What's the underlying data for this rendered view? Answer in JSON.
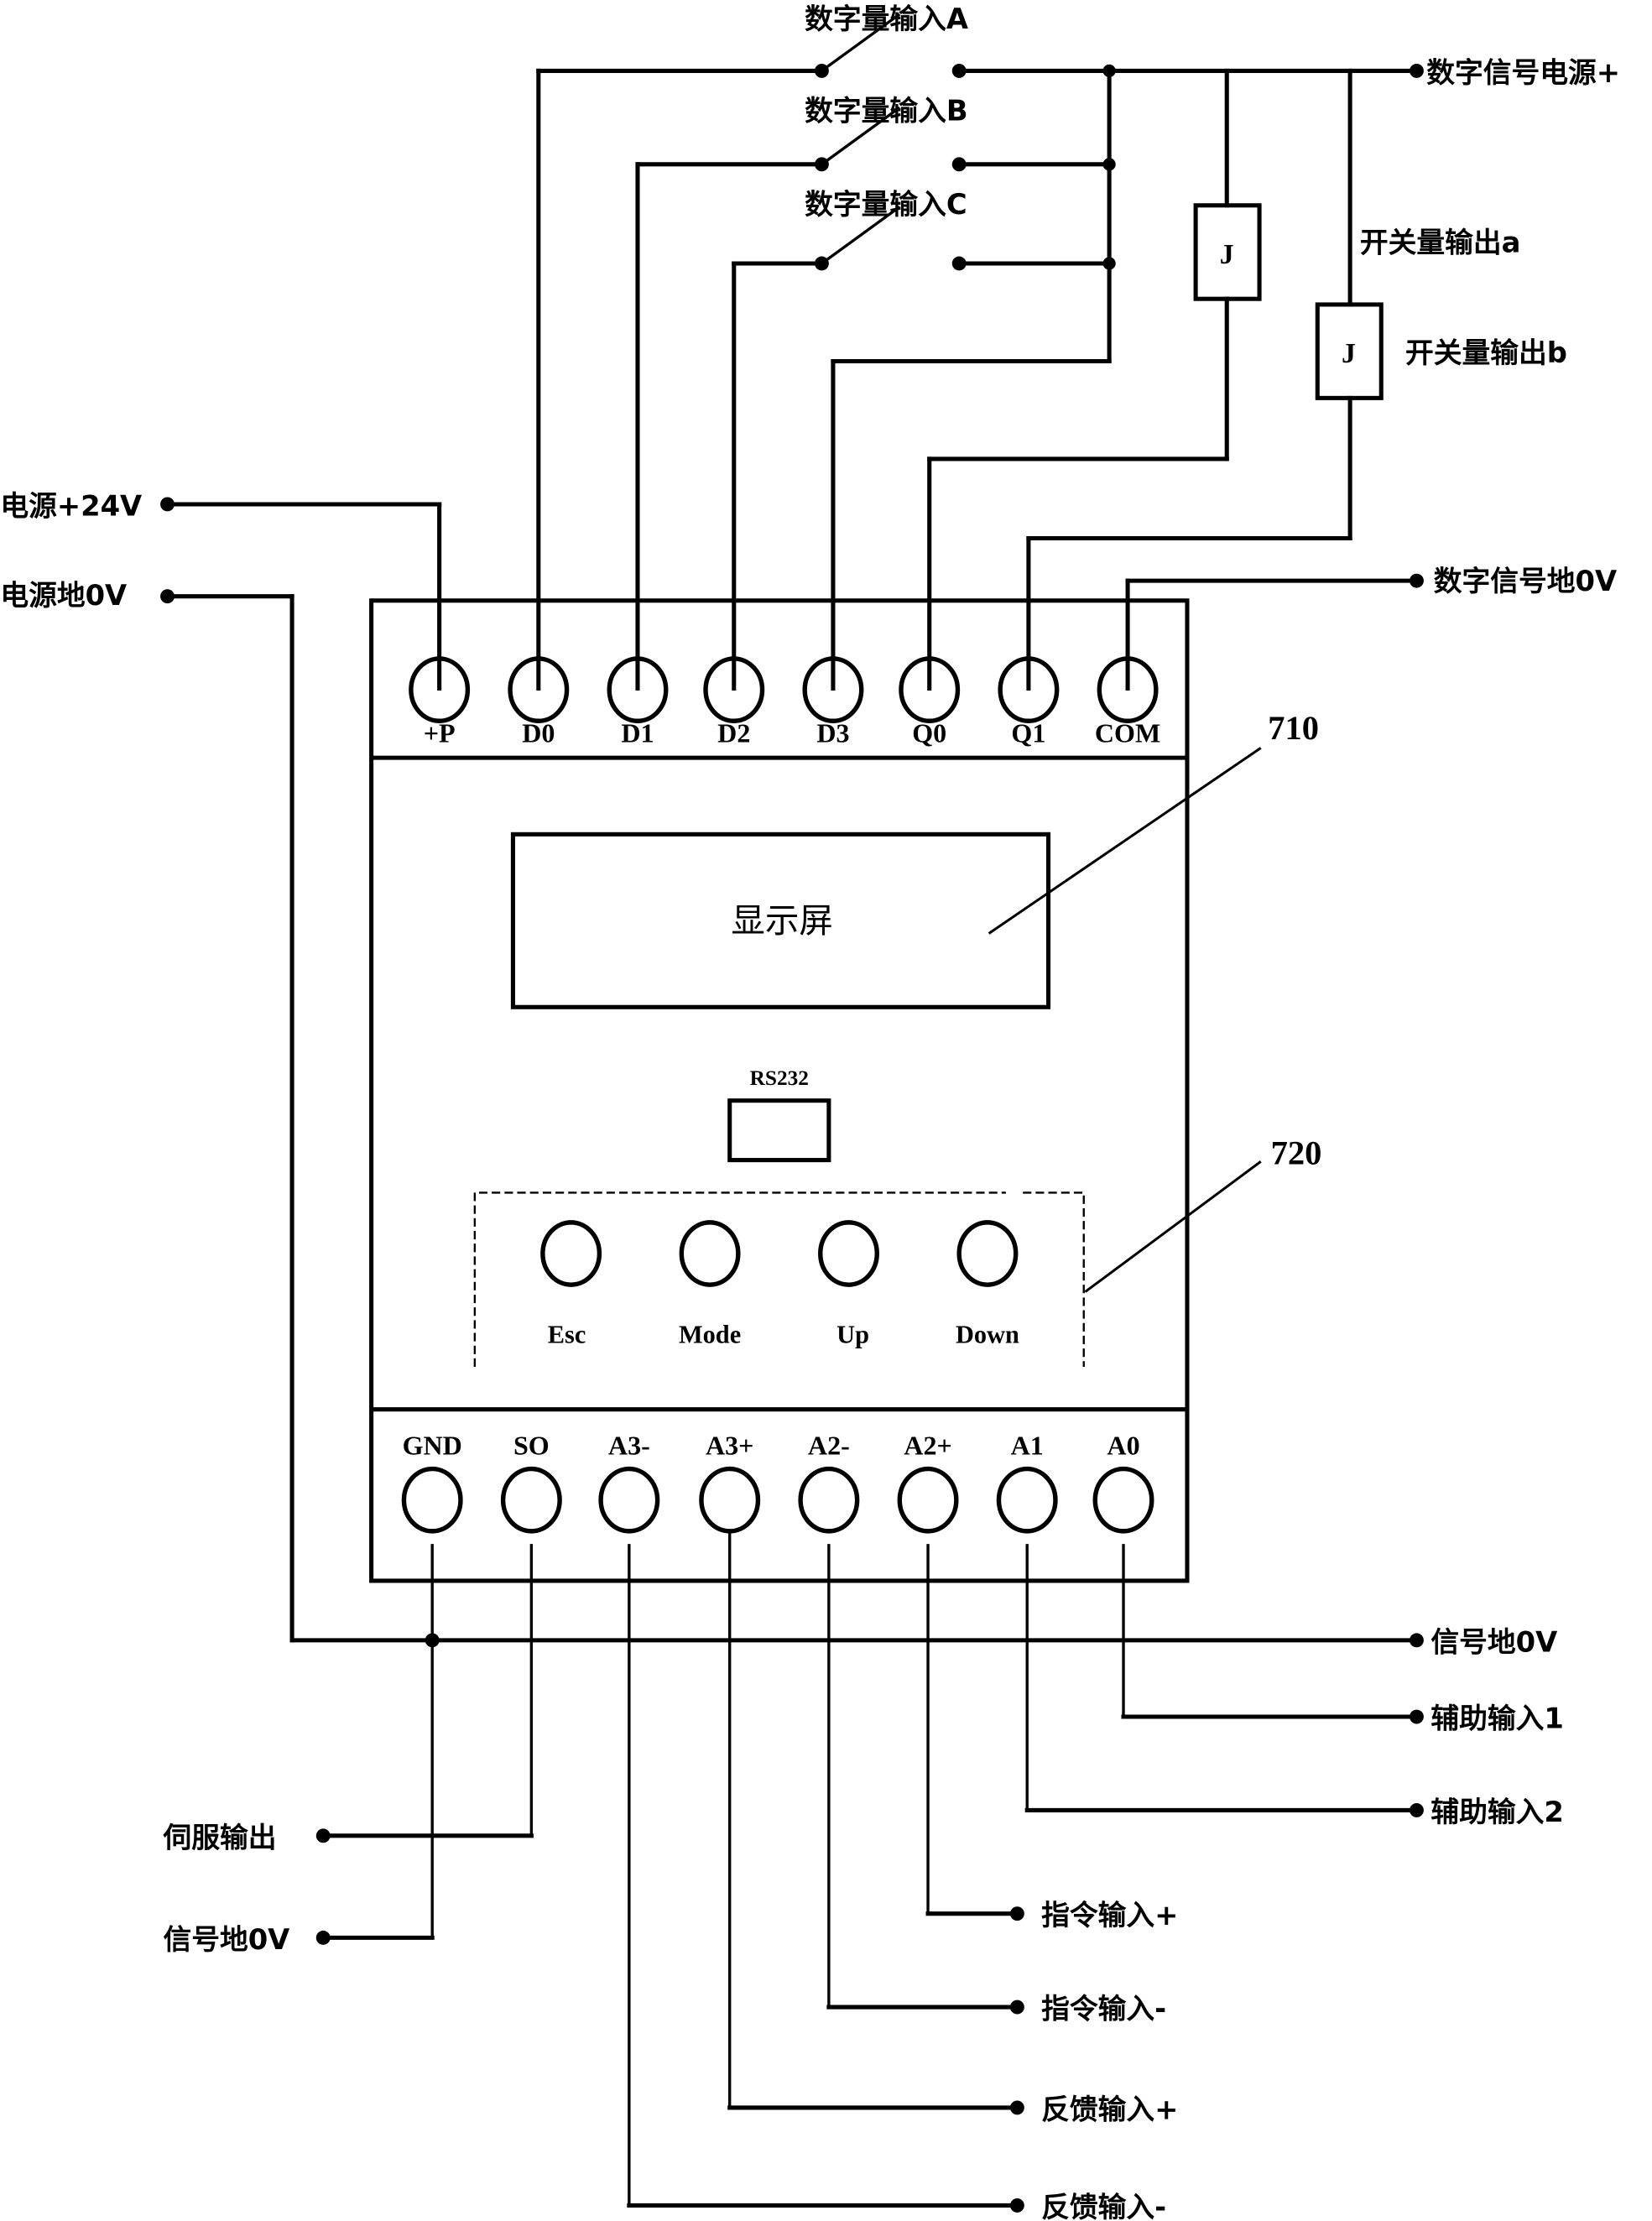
{
  "diagram": {
    "top_inputs": {
      "switch_a": "数字量输入A",
      "switch_b": "数字量输入B",
      "switch_c": "数字量输入C",
      "digital_power": "数字信号电源+",
      "relay_a_label": "开关量输出a",
      "relay_b_label": "开关量输出b",
      "relay_symbol": "J"
    },
    "left_inputs": {
      "power_24v": "电源+24V",
      "power_gnd": "电源地0V"
    },
    "right_top": {
      "digital_gnd": "数字信号地0V"
    },
    "top_terminals": [
      "+P",
      "D0",
      "D1",
      "D2",
      "D3",
      "Q0",
      "Q1",
      "COM"
    ],
    "bottom_terminals": [
      "GND",
      "SO",
      "A3-",
      "A3+",
      "A2-",
      "A2+",
      "A1",
      "A0"
    ],
    "display": {
      "label": "显示屏",
      "port": "RS232"
    },
    "buttons": [
      "Esc",
      "Mode",
      "Up",
      "Down"
    ],
    "references": {
      "display_ref": "710",
      "keypad_ref": "720"
    },
    "bottom_outputs": {
      "signal_gnd_right": "信号地0V",
      "aux_input_1": "辅助输入1",
      "aux_input_2": "辅助输入2",
      "servo_output": "伺服输出",
      "signal_gnd_left": "信号地0V",
      "command_plus": "指令输入+",
      "command_minus": "指令输入-",
      "feedback_plus": "反馈输入+",
      "feedback_minus": "反馈输入-"
    }
  }
}
